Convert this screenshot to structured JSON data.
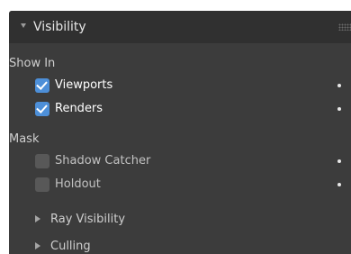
{
  "panel": {
    "title": "Visibility",
    "expand_icon": "triangle-down-icon",
    "grip_icon": "drag-grip-icon"
  },
  "show_in": {
    "label": "Show In",
    "items": [
      {
        "label": "Viewports",
        "checked": true
      },
      {
        "label": "Renders",
        "checked": true
      }
    ]
  },
  "mask": {
    "label": "Mask",
    "items": [
      {
        "label": "Shadow Catcher",
        "checked": false
      },
      {
        "label": "Holdout",
        "checked": false
      }
    ]
  },
  "subpanels": [
    {
      "label": "Ray Visibility",
      "icon": "triangle-right-icon"
    },
    {
      "label": "Culling",
      "icon": "triangle-right-icon"
    }
  ],
  "colors": {
    "panel_bg": "#3c3c3c",
    "header_bg": "#303030",
    "checkbox_checked": "#4d8fd8",
    "checkbox_unchecked": "#585858"
  }
}
